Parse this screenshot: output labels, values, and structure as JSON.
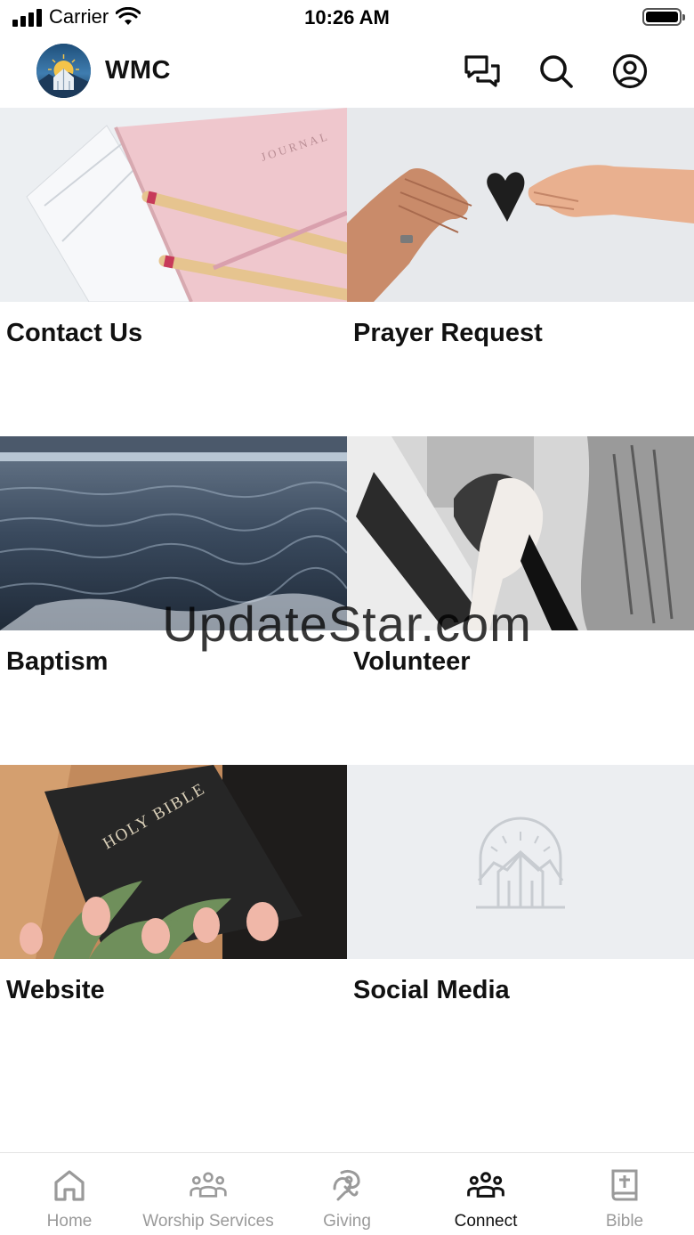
{
  "status_bar": {
    "carrier": "Carrier",
    "time": "10:26 AM"
  },
  "header": {
    "title": "WMC",
    "icons": [
      "chat-icon",
      "search-icon",
      "account-icon"
    ]
  },
  "tiles": [
    {
      "label": "Contact Us",
      "image": "journal-pencils-photo"
    },
    {
      "label": "Prayer Request",
      "image": "hands-heart-photo"
    },
    {
      "label": "Baptism",
      "image": "ocean-water-photo"
    },
    {
      "label": "Volunteer",
      "image": "clasped-hands-photo"
    },
    {
      "label": "Website",
      "image": "holy-bible-tulips-photo"
    },
    {
      "label": "Social Media",
      "image": "church-logo-placeholder"
    }
  ],
  "watermark": "UpdateStar.com",
  "tab_bar": {
    "items": [
      {
        "label": "Home",
        "icon": "home-icon",
        "active": false
      },
      {
        "label": "Worship Services",
        "icon": "people-group-icon",
        "active": false
      },
      {
        "label": "Giving",
        "icon": "giving-hand-icon",
        "active": false
      },
      {
        "label": "Connect",
        "icon": "people-group-icon",
        "active": true
      },
      {
        "label": "Bible",
        "icon": "bible-icon",
        "active": false
      }
    ]
  },
  "colors": {
    "active_tab": "#111111",
    "inactive_tab": "#9a9a9a",
    "placeholder_bg": "#eceef1"
  }
}
